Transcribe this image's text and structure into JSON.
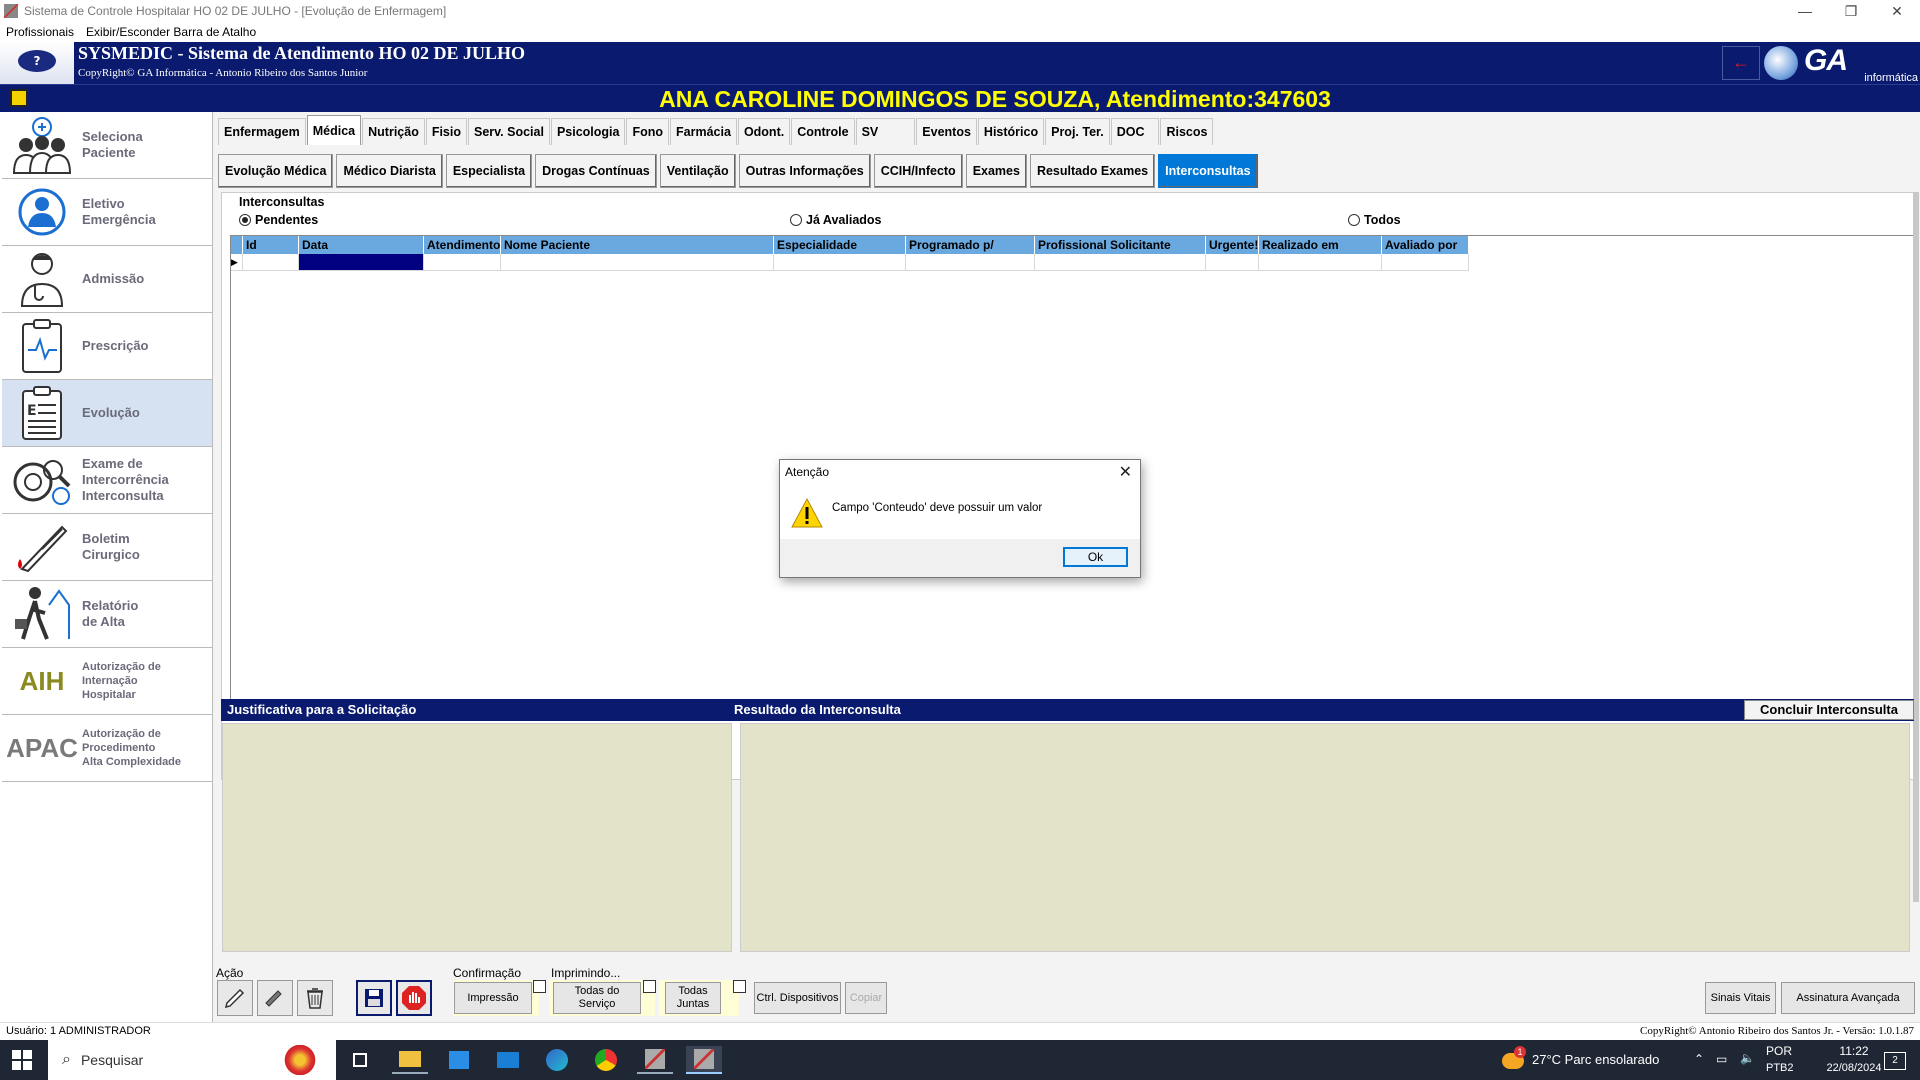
{
  "window": {
    "title": "Sistema de Controle Hospitalar HO 02 DE JULHO - [Evolução de Enfermagem]",
    "controls": [
      "—",
      "❐",
      "✕"
    ]
  },
  "menu": [
    "Profissionais",
    "Exibir/Esconder Barra de Atalho"
  ],
  "header": {
    "help": "?",
    "title": "SYSMEDIC - Sistema de Atendimento HO 02 DE JULHO",
    "copyright": "CopyRight© GA Informática - Antonio Ribeiro dos Santos Junior",
    "logo_text": "GA",
    "logo_sub": "informática",
    "accent_color": "#0a1a6e",
    "patient_color": "#ffff00"
  },
  "patient": {
    "banner": "ANA CAROLINE DOMINGOS DE SOUZA, Atendimento:347603"
  },
  "sidebar": [
    {
      "label": "Seleciona\nPaciente",
      "icon": "doctors-group-icon"
    },
    {
      "label": "Eletivo\nEmergência",
      "icon": "patient-circle-icon"
    },
    {
      "label": "Admissão",
      "icon": "doctor-icon"
    },
    {
      "label": "Prescrição",
      "icon": "clipboard-pulse-icon"
    },
    {
      "label": "Evolução",
      "icon": "clipboard-e-icon"
    },
    {
      "label": "Exame de\nIntercorrência\nInterconsulta",
      "icon": "virus-magnifier-icon"
    },
    {
      "label": "Boletim\nCirurgico",
      "icon": "scalpel-icon"
    },
    {
      "label": "Relatório\nde Alta",
      "icon": "walking-person-icon"
    },
    {
      "label": "Autorização de\nInternação\nHospitalar",
      "icon": "aih-text-icon",
      "icon_text": "AIH"
    },
    {
      "label": "Autorização de\nProcedimento\nAlta Complexidade",
      "icon": "apac-text-icon",
      "icon_text": "APAC"
    }
  ],
  "tabs_primary": [
    "Enfermagem",
    "Médica",
    "Nutrição",
    "Fisio",
    "Serv. Social",
    "Psicologia",
    "Fono",
    "Farmácia",
    "Odont.",
    "Controle",
    "SV",
    "Eventos",
    "Histórico",
    "Proj. Ter.",
    "DOC",
    "Riscos"
  ],
  "tabs_primary_active": "Médica",
  "tabs_secondary": [
    "Evolução Médica",
    "Médico Diarista",
    "Especialista",
    "Drogas Contínuas",
    "Ventilação",
    "Outras Informações",
    "CCIH/Infecto",
    "Exames",
    "Resultado Exames",
    "Interconsultas"
  ],
  "tabs_secondary_active": "Interconsultas",
  "interconsultas": {
    "caption": "Interconsultas",
    "filters": [
      {
        "label": "Pendentes",
        "selected": true
      },
      {
        "label": "Já Avaliados",
        "selected": false
      },
      {
        "label": "Todos",
        "selected": false
      }
    ],
    "columns": [
      "Id",
      "Data",
      "Atendimento",
      "Nome Paciente",
      "Especialidade",
      "Programado p/",
      "Profissional Solicitante",
      "Urgente!",
      "Realizado em",
      "Avaliado por"
    ],
    "row_indicator": "▶"
  },
  "bottom": {
    "justificativa_label": "Justificativa para a Solicitação",
    "resultado_label": "Resultado da Interconsulta",
    "concluir_button": "Concluir Interconsulta"
  },
  "actionbar": {
    "acao_label": "Ação",
    "confirmacao_label": "Confirmação",
    "imprimindo_label": "Imprimindo...",
    "impressao": "Impressão",
    "todas_servico": "Todas do\nServiço",
    "todas_juntas": "Todas\nJuntas",
    "ctrl_dispositivos": "Ctrl. Dispositivos",
    "copiar": "Copiar",
    "sinais_vitais": "Sinais Vitais",
    "assinatura": "Assinatura Avançada"
  },
  "statusbar": {
    "user": "Usuário:  1   ADMINISTRADOR",
    "copyright": "CopyRight© Antonio Ribeiro dos Santos Jr. - Versão: 1.0.1.87"
  },
  "dialog": {
    "title": "Atenção",
    "close": "✕",
    "message": "Campo 'Conteudo' deve possuir um valor",
    "ok": "Ok"
  },
  "taskbar": {
    "search": "Pesquisar",
    "weather": "27°C  Parc ensolarado",
    "weather_badge": "1",
    "lang": "POR",
    "layout": "PTB2",
    "time": "11:22",
    "date": "22/08/2024",
    "notifications": "2"
  }
}
